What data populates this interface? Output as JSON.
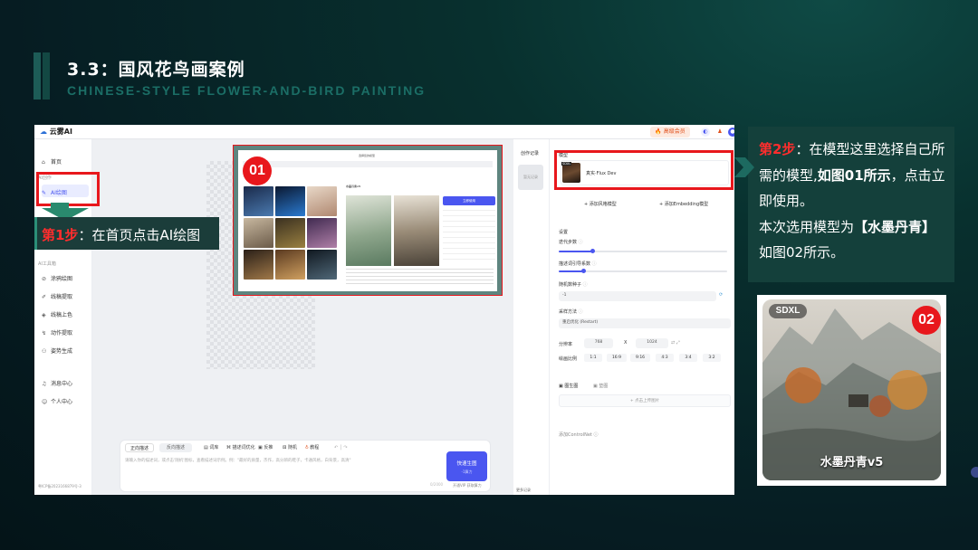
{
  "slide": {
    "title": "3.3：国风花鸟画案例",
    "subtitle": "CHINESE-STYLE FLOWER-AND-BIRD PAINTING"
  },
  "app": {
    "logo": "云雾AI",
    "vip_button": "高级会员",
    "sidebar": {
      "home": "首页",
      "group_ai_create": "AI创作",
      "ai_draw": "AI绘图",
      "group_ai_tools": "AI工具箱",
      "tools": [
        "涂鸦绘图",
        "线稿提取",
        "线稿上色",
        "动作提取",
        "姿势生成"
      ],
      "messages": "消息中心",
      "profile": "个人中心",
      "footer": "粤ICP备2023166879号-3"
    },
    "prompt": {
      "tab_positive": "正向描述",
      "tab_negative": "反向描述",
      "tools": [
        "词库",
        "描述词优化",
        "反推",
        "随机",
        "教程"
      ],
      "placeholder": "请输入你的描述词，或点击'随机'图标，查看描述词示例。例：\"最好的质量，杰作，高分辨的鞋子，卡通风格，白背景，高清\"",
      "generate": "快速生图",
      "generate_sub": "-1算力",
      "counter": "0/2000",
      "vip_note": "开通VIP 获取算力"
    },
    "record": {
      "label": "创作记录",
      "thumb": "暂无记录",
      "footer": "更多记录"
    },
    "panel": {
      "model_label": "模型",
      "model_tag": "SDXL",
      "model_name": "真实·Flux Dev",
      "add_style_model": "添加风格模型",
      "add_embedding": "添加Embedding模型",
      "settings": "设置",
      "steps": "迭代步数",
      "cfg": "描述词引导系数",
      "seed": "随机数种子",
      "seed_value": "-1",
      "sampler": "采样方法",
      "sampler_value": "重启优化 (Restart)",
      "resolution": "分辨率",
      "width": "768",
      "x": "X",
      "height": "1024",
      "ratio_label": "绘画比例",
      "ratios": [
        "1:1",
        "16:9",
        "9:16",
        "4:3",
        "3:4",
        "3:2"
      ],
      "img2img": "图生图",
      "ref_image": "垫图",
      "upload": "点击上传图片",
      "controlnet": "添加ControlNet"
    }
  },
  "inner_shot": {
    "header": "选择您的模型",
    "model_name": "水墨丹青v5",
    "use_button": "立即使用"
  },
  "badges": {
    "b01": "01",
    "b02": "02"
  },
  "step1": {
    "prefix": "第1步",
    "text": "：在首页点击AI绘图"
  },
  "step2": {
    "prefix": "第2步",
    "text1": "：在模型这里选择自己所需的模型,",
    "bold1": "如图01所示",
    "text2": "，点击立即使用。",
    "line2_a": "本次选用模型为",
    "line2_bold": "【水墨丹青】",
    "line2_b": "如图02所示。"
  },
  "card2": {
    "tag": "SDXL",
    "label": "水墨丹青v5"
  }
}
